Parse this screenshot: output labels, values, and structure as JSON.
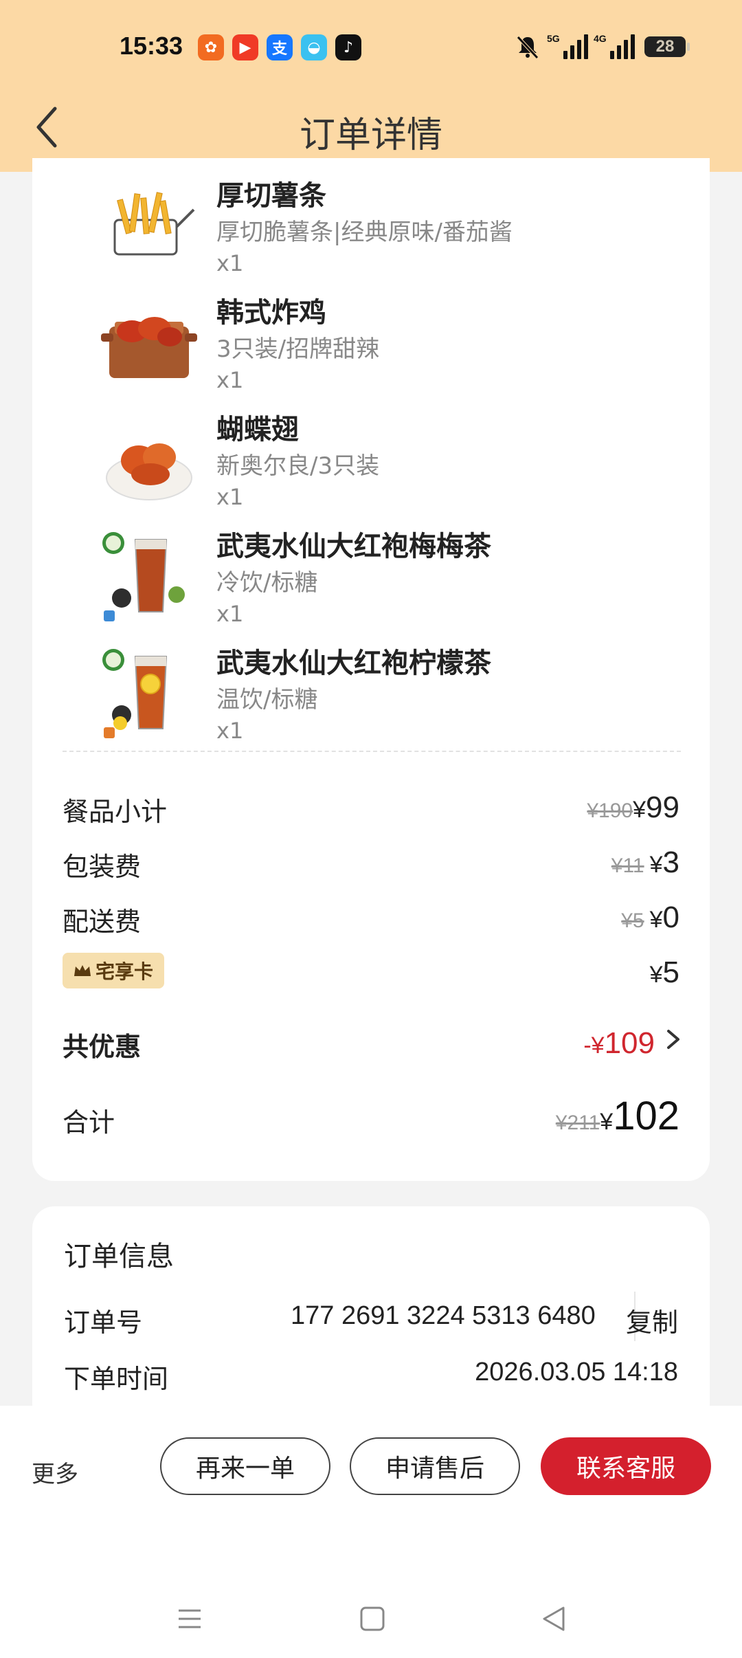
{
  "status_bar": {
    "time": "15:33",
    "network1": "5G",
    "network2": "4G",
    "battery": "28",
    "app_icons": [
      "app-icon-orange",
      "video-icon",
      "alipay-icon",
      "bird-app-icon",
      "tiktok-icon"
    ]
  },
  "header": {
    "title": "订单详情",
    "back_icon": "chevron-left-icon"
  },
  "items": [
    {
      "name": "厚切薯条",
      "spec": "厚切脆薯条|经典原味/番茄酱",
      "qty": "x1"
    },
    {
      "name": "韩式炸鸡",
      "spec": "3只装/招牌甜辣",
      "qty": "x1"
    },
    {
      "name": "蝴蝶翅",
      "spec": "新奥尔良/3只装",
      "qty": "x1"
    },
    {
      "name": "武夷水仙大红袍梅梅茶",
      "spec": "冷饮/标糖",
      "qty": "x1"
    },
    {
      "name": "武夷水仙大红袍柠檬茶",
      "spec": "温饮/标糖",
      "qty": "x1"
    }
  ],
  "summary": {
    "subtotal": {
      "label": "餐品小计",
      "original": "¥190",
      "currency": "¥",
      "amount": "99"
    },
    "packaging": {
      "label": "包装费",
      "original": "¥11",
      "currency": "¥",
      "amount": "3"
    },
    "delivery": {
      "label": "配送费",
      "original": "¥5",
      "currency": "¥",
      "amount": "0"
    },
    "card": {
      "label": "宅享卡",
      "currency": "¥",
      "amount": "5"
    },
    "discount": {
      "label": "共优惠",
      "prefix": "-",
      "currency": "¥",
      "amount": "109"
    },
    "total": {
      "label": "合计",
      "original": "¥211",
      "currency": "¥",
      "amount": "102"
    }
  },
  "order_info": {
    "title": "订单信息",
    "order_no_label": "订单号",
    "order_no": "177 2691 3224 5313 6480",
    "copy_label": "复制",
    "time_label": "下单时间",
    "time": "2026.03.05 14:18"
  },
  "actions": {
    "more": "更多",
    "reorder": "再来一单",
    "after_sale": "申请售后",
    "contact": "联系客服"
  },
  "colors": {
    "header_bg": "#fcd9a5",
    "accent_red": "#d4202d",
    "badge_bg": "#f6dfae"
  }
}
